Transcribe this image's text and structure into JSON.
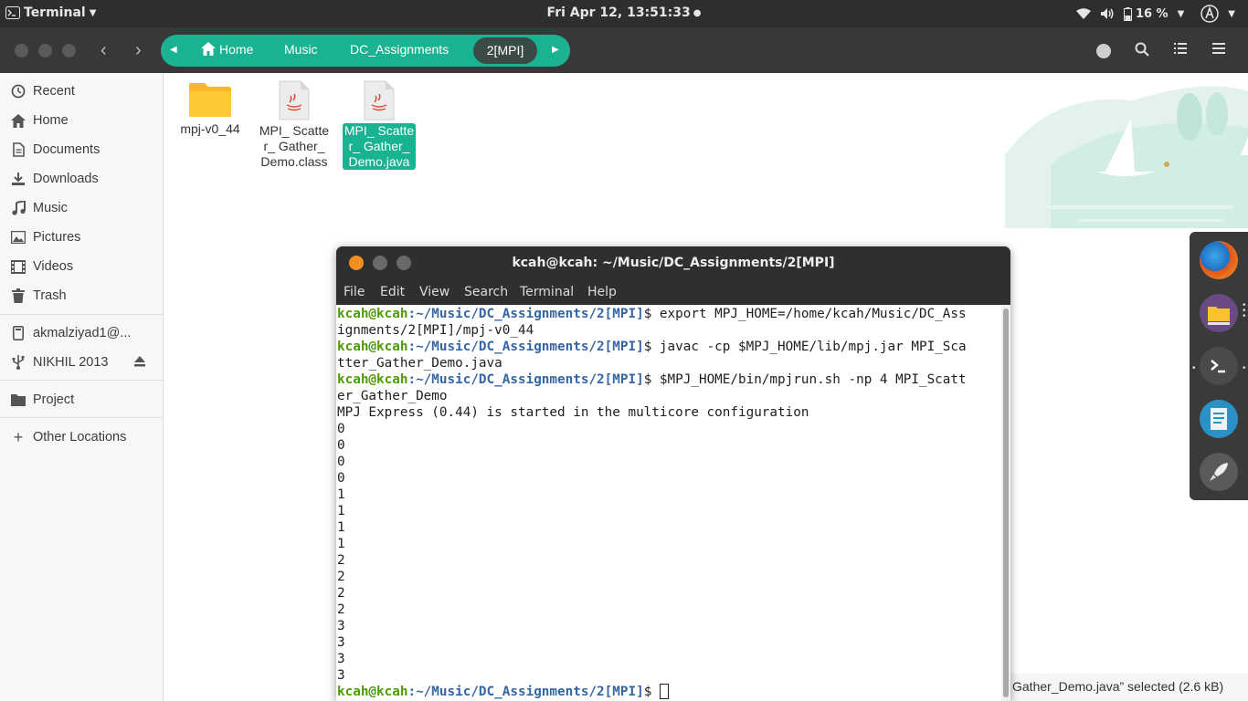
{
  "topbar": {
    "app_name": "Terminal",
    "clock": "Fri Apr 12, 13:51:33",
    "battery": "16 %"
  },
  "nautilus": {
    "path": [
      "Home",
      "Music",
      "DC_Assignments",
      "2[MPI]"
    ]
  },
  "sidebar": {
    "items": [
      {
        "label": "Recent",
        "icon": "clock-icon"
      },
      {
        "label": "Home",
        "icon": "home-icon"
      },
      {
        "label": "Documents",
        "icon": "document-icon"
      },
      {
        "label": "Downloads",
        "icon": "download-icon"
      },
      {
        "label": "Music",
        "icon": "music-icon"
      },
      {
        "label": "Pictures",
        "icon": "picture-icon"
      },
      {
        "label": "Videos",
        "icon": "video-icon"
      },
      {
        "label": "Trash",
        "icon": "trash-icon"
      },
      {
        "label": "akmalziyad1@...",
        "icon": "account-icon"
      },
      {
        "label": "NIKHIL 2013",
        "icon": "usb-icon"
      },
      {
        "label": "Project",
        "icon": "folder-icon"
      },
      {
        "label": "Other Locations",
        "icon": "plus-icon"
      }
    ]
  },
  "files": [
    {
      "name": "mpj-v0_44",
      "type": "folder"
    },
    {
      "name": "MPI_ Scatter_ Gather_ Demo.class",
      "type": "java"
    },
    {
      "name": "MPI_ Scatter_ Gather_ Demo.java",
      "type": "java",
      "selected": true
    }
  ],
  "status": "Gather_Demo.java” selected  (2.6 kB)",
  "terminal": {
    "title": "kcah@kcah: ~/Music/DC_Assignments/2[MPI]",
    "menu": [
      "File",
      "Edit",
      "View",
      "Search",
      "Terminal",
      "Help"
    ],
    "prompt_user": "kcah@kcah",
    "prompt_path": ":~/Music/DC_Assignments/2[MPI]",
    "lines": [
      {
        "kind": "prompt",
        "text": "$ export MPJ_HOME=/home/kcah/Music/DC_Ass"
      },
      {
        "kind": "out",
        "text": "ignments/2[MPI]/mpj-v0_44"
      },
      {
        "kind": "prompt",
        "text": "$ javac -cp $MPJ_HOME/lib/mpj.jar MPI_Sca"
      },
      {
        "kind": "out",
        "text": "tter_Gather_Demo.java"
      },
      {
        "kind": "prompt",
        "text": "$ $MPJ_HOME/bin/mpjrun.sh -np 4 MPI_Scatt"
      },
      {
        "kind": "out",
        "text": "er_Gather_Demo"
      },
      {
        "kind": "out",
        "text": "MPJ Express (0.44) is started in the multicore configuration"
      },
      {
        "kind": "out",
        "text": "0"
      },
      {
        "kind": "out",
        "text": "0"
      },
      {
        "kind": "out",
        "text": "0"
      },
      {
        "kind": "out",
        "text": "0"
      },
      {
        "kind": "out",
        "text": "1"
      },
      {
        "kind": "out",
        "text": "1"
      },
      {
        "kind": "out",
        "text": "1"
      },
      {
        "kind": "out",
        "text": "1"
      },
      {
        "kind": "out",
        "text": "2"
      },
      {
        "kind": "out",
        "text": "2"
      },
      {
        "kind": "out",
        "text": "2"
      },
      {
        "kind": "out",
        "text": "2"
      },
      {
        "kind": "out",
        "text": "3"
      },
      {
        "kind": "out",
        "text": "3"
      },
      {
        "kind": "out",
        "text": "3"
      },
      {
        "kind": "out",
        "text": "3"
      },
      {
        "kind": "prompt",
        "text": "$ ",
        "cursor": true
      }
    ]
  },
  "colors": {
    "accent": "#19b391",
    "prompt_user": "#4e9a06",
    "prompt_path": "#3465a4"
  }
}
